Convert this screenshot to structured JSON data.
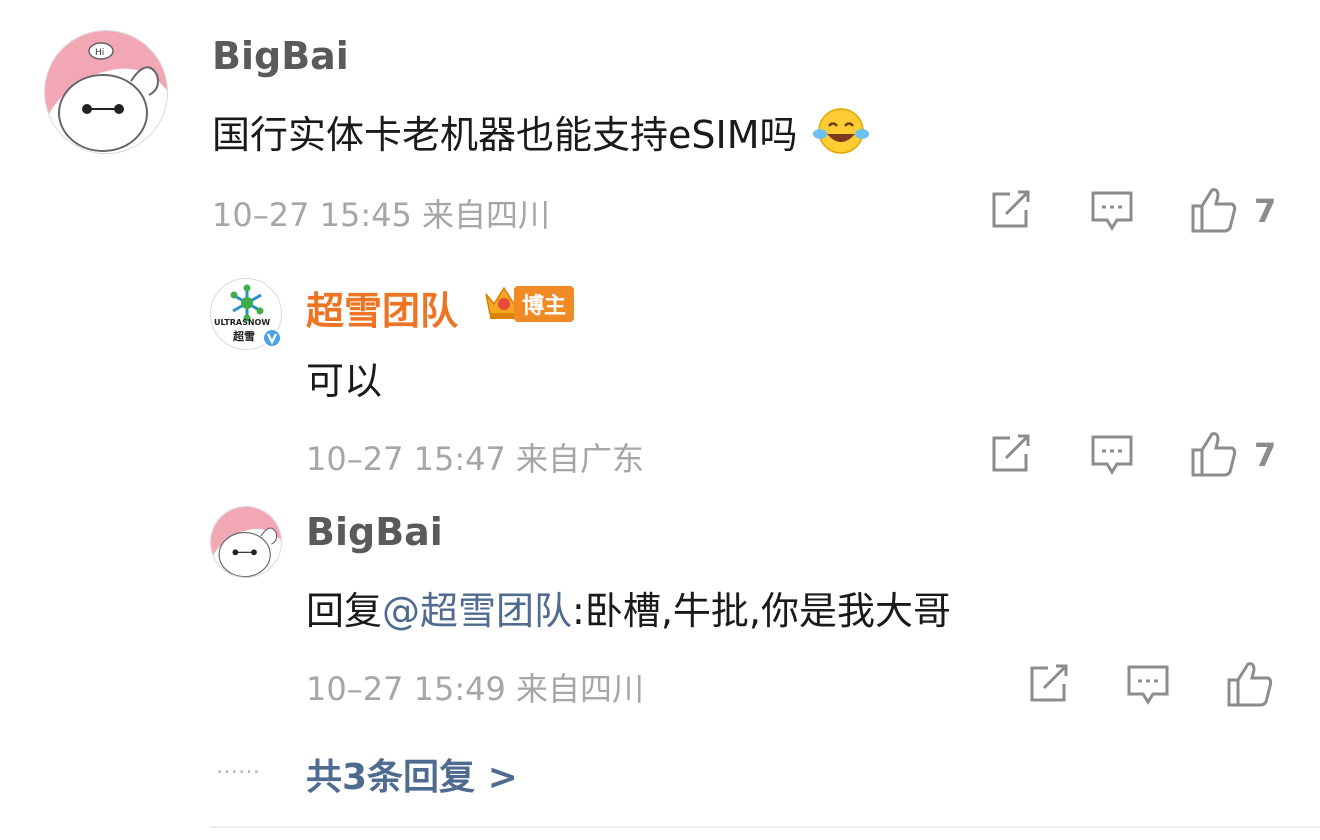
{
  "comment": {
    "user": "BigBai",
    "text": "国行实体卡老机器也能支持eSIM吗",
    "meta": "10–27 15:45 来自四川",
    "likes": "7"
  },
  "reply1": {
    "user": "超雪团队",
    "badge": "博主",
    "avatar_text": "ULTRASNOW",
    "avatar_sub": "超雪",
    "text": "可以",
    "meta": "10–27 15:47 来自广东",
    "likes": "7"
  },
  "reply2": {
    "user": "BigBai",
    "prefix": "回复",
    "mention": "@超雪团队",
    "text": ":卧槽,牛批,你是我大哥",
    "meta": "10–27 15:49 来自四川"
  },
  "more": {
    "dots": "……",
    "label": "共3条回复 >"
  },
  "colors": {
    "name_orange": "#ee7424",
    "link_blue": "#4f6b90",
    "avatar_pink": "#f2a7b5"
  }
}
